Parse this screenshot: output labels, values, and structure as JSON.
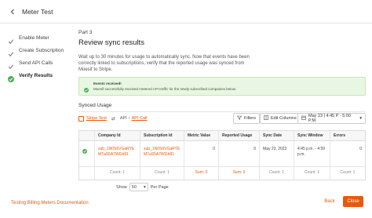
{
  "window": {
    "title": "Meter Test"
  },
  "steps": [
    {
      "label": "Enable Meter",
      "done": true
    },
    {
      "label": "Create Subscription",
      "done": true
    },
    {
      "label": "Send API Calls",
      "done": true
    },
    {
      "label": "Verify Results",
      "done": true
    }
  ],
  "main": {
    "part": "Part 3",
    "heading": "Review sync results",
    "description": "Wait up to 30 minutes for usage to automatically sync. Now that events have been correctly linked to subscriptions, verify that the reported usage was synced from Moesif to Stripe."
  },
  "banner": {
    "title": "Events received!",
    "body": "Moesif successfully received metered API traffic for the newly subscribed companies below."
  },
  "synced": {
    "label": "Synced Usage",
    "stripe_link": "Stripe Test",
    "api_prefix": "API",
    "api_link": "API Call",
    "filters_label": "Filters",
    "edit_columns_label": "Edit Columns",
    "date_range": "May 23 | 4:45 P - 5:00 P.M."
  },
  "table": {
    "headers": [
      "Company Id",
      "Subscription Id",
      "Metric Value",
      "Reported Usage",
      "Sync Date",
      "Sync Window",
      "Errors"
    ],
    "row": {
      "company_id": "sub_1N0S6VGaRYE M7aS5A7WGh81",
      "subscription_id": "sub_1N0S6VGaRYE M7aS5A7WGh81",
      "metric_value": "0",
      "reported_usage": "0",
      "sync_date": "May 23, 2023",
      "sync_window": "4:45 p.m. - 4:59 p.m.",
      "errors": "0"
    },
    "counts": [
      "Count: 1",
      "Count: 1",
      "Sum: 0",
      "Sum: 0",
      "Count: 1",
      "Count: 1",
      "Count: 1"
    ]
  },
  "pagination": {
    "show_label": "Show",
    "per_page_value": "50",
    "per_page_label": "Per Page"
  },
  "footer": {
    "docs_link": "Testing Billing Meters Documentation",
    "back_label": "Back",
    "close_label": "Close"
  },
  "colors": {
    "accent": "#e8590c",
    "success": "#4caf50",
    "banner_bg": "#e9f6e4"
  }
}
